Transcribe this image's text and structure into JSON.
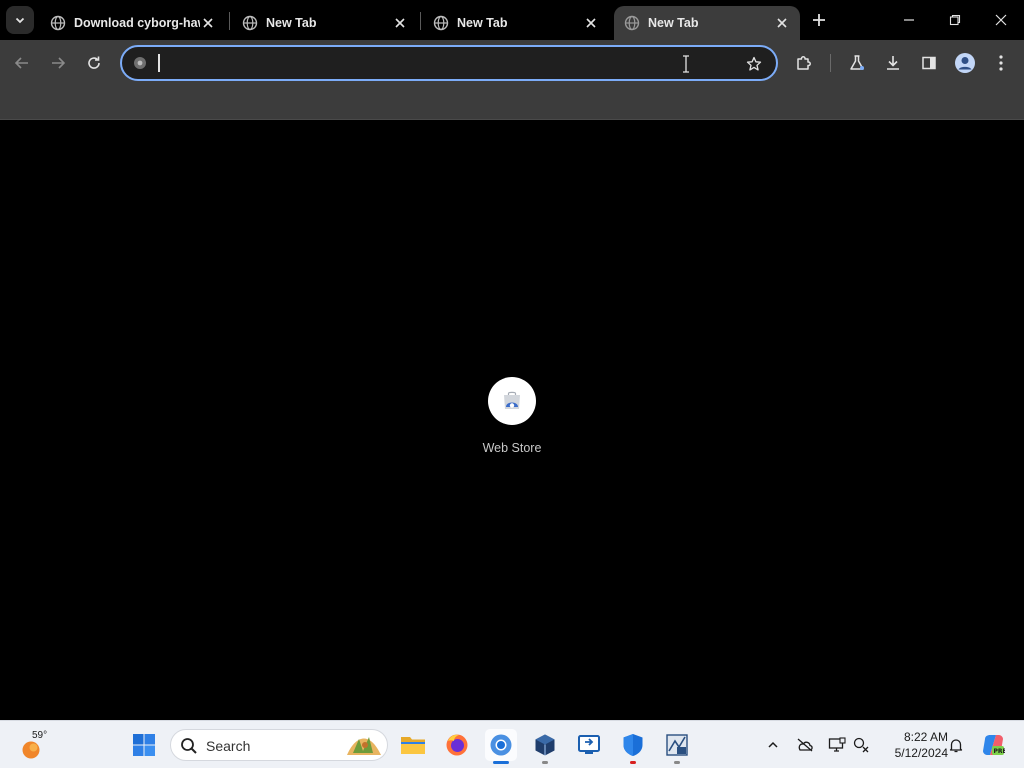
{
  "browser": {
    "tabs": [
      {
        "title": "Download cyborg-haw",
        "active": false
      },
      {
        "title": "New Tab",
        "active": false
      },
      {
        "title": "New Tab",
        "active": false
      },
      {
        "title": "New Tab",
        "active": true
      }
    ],
    "omnibox": {
      "value": "",
      "placeholder": ""
    },
    "accent_color": "#7cacf8"
  },
  "new_tab_page": {
    "shortcuts": [
      {
        "label": "Web Store",
        "icon": "web-store-icon"
      }
    ]
  },
  "taskbar": {
    "weather": {
      "temp": "59°",
      "icon": "sun-icon"
    },
    "search_label": "Search",
    "apps": [
      "start-menu-icon",
      "file-explorer-icon",
      "firefox-icon",
      "chrome-icon",
      "virtualbox-icon",
      "remote-desktop-icon",
      "windows-security-icon",
      "system-info-icon"
    ],
    "tray": [
      "chevron-up-icon",
      "onedrive-offline-icon",
      "display-icon",
      "network-icon"
    ],
    "clock": {
      "time": "8:22 AM",
      "date": "5/12/2024"
    }
  }
}
